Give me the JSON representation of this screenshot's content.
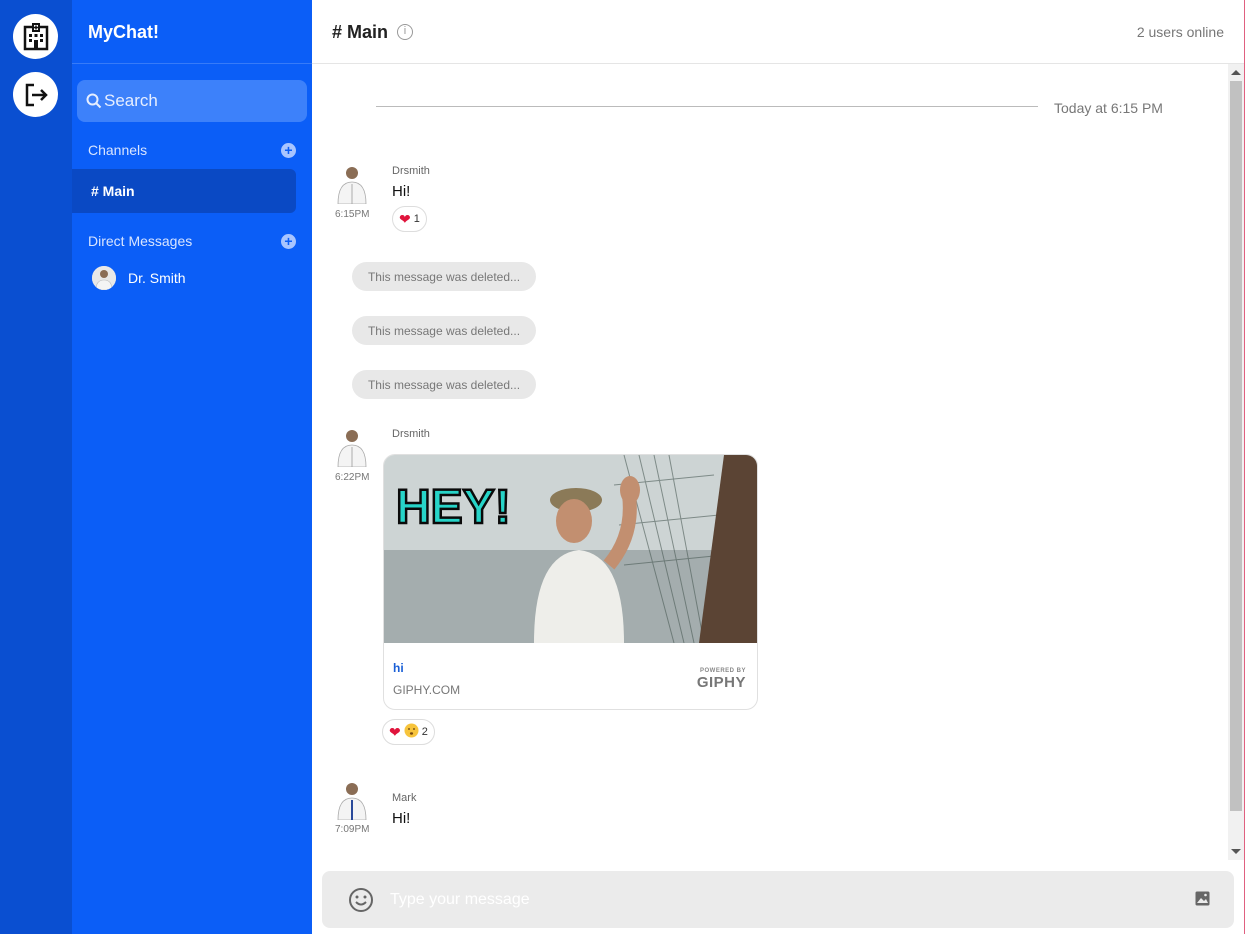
{
  "app": {
    "brand": "MyChat!"
  },
  "search": {
    "placeholder": "Search"
  },
  "sidebar": {
    "channels_label": "Channels",
    "channels": [
      {
        "label": "# Main",
        "active": true
      }
    ],
    "dm_label": "Direct Messages",
    "dms": [
      {
        "label": "Dr. Smith"
      }
    ]
  },
  "header": {
    "title": "# Main",
    "online": "2 users online"
  },
  "date_separator": "Today at 6:15 PM",
  "messages": [
    {
      "author": "Drsmith",
      "time": "6:15PM",
      "text": "Hi!",
      "reactions": {
        "emojis": [
          "heart"
        ],
        "count": "1"
      }
    },
    {
      "deleted_text": "This message was deleted..."
    },
    {
      "deleted_text": "This message was deleted..."
    },
    {
      "deleted_text": "This message was deleted..."
    },
    {
      "author": "Drsmith",
      "time": "6:22PM",
      "giphy": {
        "overlay_text": "HEY!",
        "title": "hi",
        "domain": "GIPHY.COM",
        "powered_by": "POWERED BY",
        "logo": "GIPHY"
      },
      "reactions": {
        "emojis": [
          "heart",
          "hushed-face"
        ],
        "count": "2"
      }
    },
    {
      "author": "Mark",
      "time": "7:09PM",
      "text": "Hi!"
    }
  ],
  "composer": {
    "placeholder": "Type your message"
  },
  "colors": {
    "rail": "#0a4fd1",
    "sidebar": "#0b5ef7",
    "active_channel": "#0a49c4",
    "search_bg": "#3d81fa",
    "composer_bg": "#ebebeb"
  },
  "icons": [
    "hospital-building-icon",
    "logout-icon",
    "search-icon",
    "add-channel-icon",
    "add-dm-icon",
    "info-icon",
    "emoji-icon",
    "image-upload-icon",
    "heart-icon",
    "hushed-face-icon"
  ]
}
